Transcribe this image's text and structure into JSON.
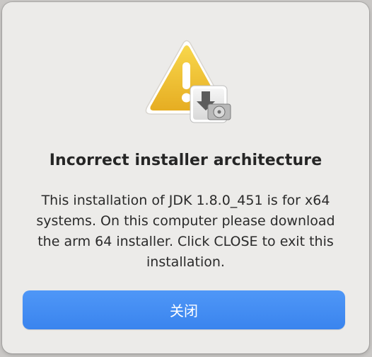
{
  "dialog": {
    "icon": "warning-installer-icon",
    "title": "Incorrect installer architecture",
    "message": "This installation of JDK 1.8.0_451 is for x64 systems. On this computer please download the arm 64 installer. Click CLOSE to exit this installation.",
    "close_button_label": "关闭"
  },
  "colors": {
    "button_accent": "#3b86f0",
    "warning_yellow": "#f2c335",
    "dialog_background": "#ecebe9"
  }
}
